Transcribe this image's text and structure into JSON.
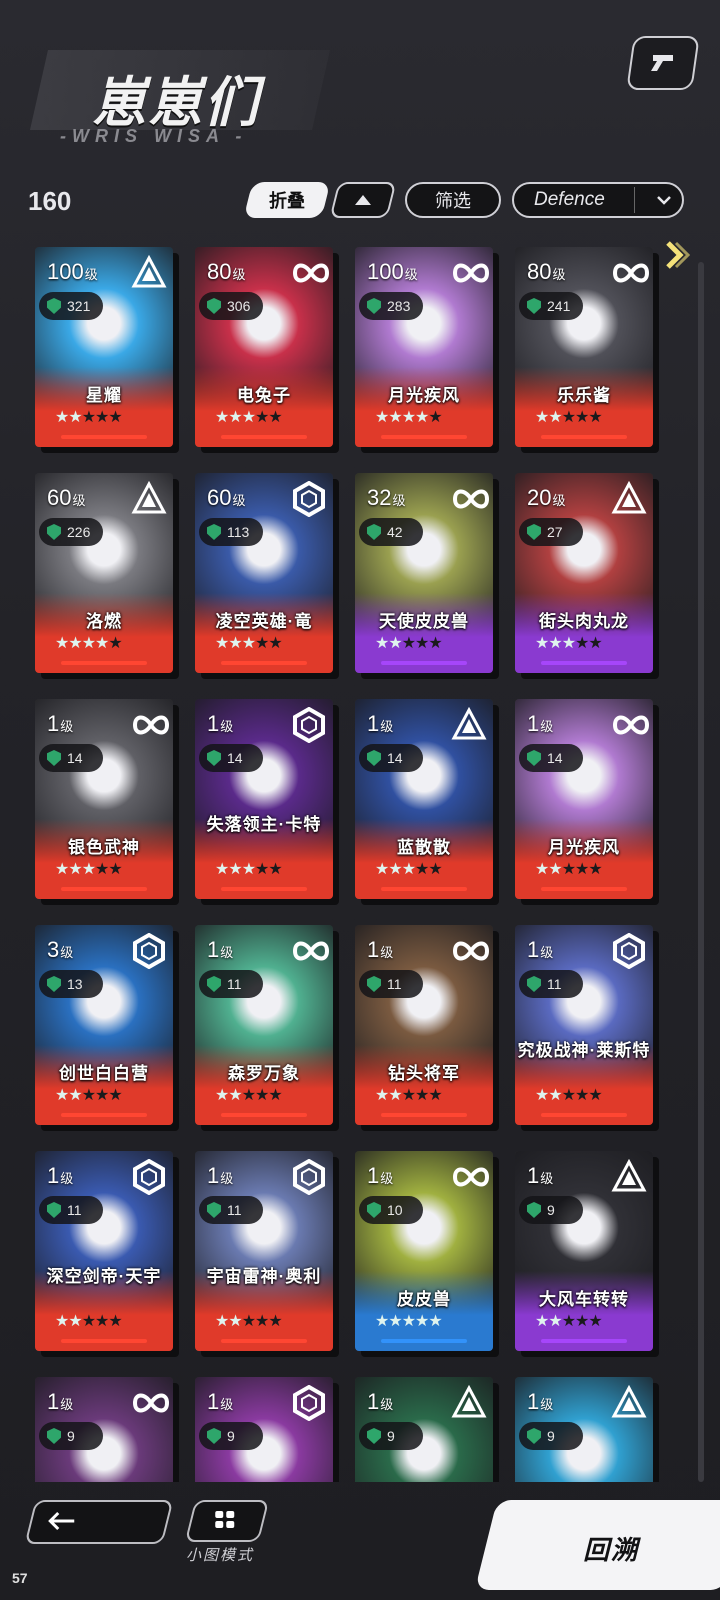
{
  "header": {
    "title": "崽崽们",
    "subtitle": "-WRIS WISA -",
    "count": "160",
    "fold_label": "折叠",
    "filter_label": "筛选",
    "sort_value": "Defence",
    "level_suffix": "级"
  },
  "cards": [
    {
      "level": "100",
      "power": "321",
      "name": "星耀",
      "type": "triangle",
      "stars": 2,
      "rarity": "red",
      "art": "#3aa8e6"
    },
    {
      "level": "80",
      "power": "306",
      "name": "电兔子",
      "type": "infinity",
      "stars": 3,
      "rarity": "red",
      "art": "#c8304a"
    },
    {
      "level": "100",
      "power": "283",
      "name": "月光疾风",
      "type": "infinity",
      "stars": 4,
      "rarity": "red",
      "art": "#b07ad0"
    },
    {
      "level": "80",
      "power": "241",
      "name": "乐乐酱",
      "type": "infinity",
      "stars": 2,
      "rarity": "red",
      "art": "#505058"
    },
    {
      "level": "60",
      "power": "226",
      "name": "洛燃",
      "type": "triangle",
      "stars": 4,
      "rarity": "red",
      "art": "#7a7a80"
    },
    {
      "level": "60",
      "power": "113",
      "name": "凌空英雄·竜",
      "type": "hex",
      "stars": 3,
      "rarity": "red",
      "art": "#3a5aa8"
    },
    {
      "level": "32",
      "power": "42",
      "name": "天使皮皮兽",
      "type": "infinity",
      "stars": 2,
      "rarity": "purple",
      "art": "#9aa050"
    },
    {
      "level": "20",
      "power": "27",
      "name": "街头肉丸龙",
      "type": "triangle",
      "stars": 3,
      "rarity": "purple",
      "art": "#b04040"
    },
    {
      "level": "1",
      "power": "14",
      "name": "银色武神",
      "type": "infinity",
      "stars": 3,
      "rarity": "red",
      "art": "#606066"
    },
    {
      "level": "1",
      "power": "14",
      "name": "失落领主·卡特",
      "type": "hex",
      "stars": 3,
      "rarity": "red",
      "art": "#5a2a8a"
    },
    {
      "level": "1",
      "power": "14",
      "name": "蓝散散",
      "type": "triangle",
      "stars": 3,
      "rarity": "red",
      "art": "#3050a0"
    },
    {
      "level": "1",
      "power": "14",
      "name": "月光疾风",
      "type": "infinity",
      "stars": 2,
      "rarity": "red",
      "art": "#b07ad0"
    },
    {
      "level": "3",
      "power": "13",
      "name": "创世白白营",
      "type": "hex",
      "stars": 2,
      "rarity": "red",
      "art": "#2a70c0"
    },
    {
      "level": "1",
      "power": "11",
      "name": "森罗万象",
      "type": "infinity",
      "stars": 2,
      "rarity": "red",
      "art": "#50b090"
    },
    {
      "level": "1",
      "power": "11",
      "name": "钻头将军",
      "type": "infinity",
      "stars": 2,
      "rarity": "red",
      "art": "#7a5a40"
    },
    {
      "level": "1",
      "power": "11",
      "name": "究极战神·莱斯特",
      "type": "hex",
      "stars": 2,
      "rarity": "red",
      "art": "#5a6ac0"
    },
    {
      "level": "1",
      "power": "11",
      "name": "深空剑帝·天宇",
      "type": "hex",
      "stars": 2,
      "rarity": "red",
      "art": "#3a5ab0"
    },
    {
      "level": "1",
      "power": "11",
      "name": "宇宙雷神·奥利",
      "type": "hex",
      "stars": 2,
      "rarity": "red",
      "art": "#6a7ab0"
    },
    {
      "level": "1",
      "power": "10",
      "name": "皮皮兽",
      "type": "infinity",
      "stars": 5,
      "rarity": "blue",
      "art": "#a0b040"
    },
    {
      "level": "1",
      "power": "9",
      "name": "大风车转转",
      "type": "triangle",
      "stars": 2,
      "rarity": "purple",
      "art": "#303036"
    },
    {
      "level": "1",
      "power": "9",
      "name": "",
      "type": "infinity",
      "stars": 0,
      "rarity": "red",
      "art": "#6a3a7a"
    },
    {
      "level": "1",
      "power": "9",
      "name": "",
      "type": "hex",
      "stars": 0,
      "rarity": "red",
      "art": "#8a3aa0"
    },
    {
      "level": "1",
      "power": "9",
      "name": "",
      "type": "triangle",
      "stars": 0,
      "rarity": "red",
      "art": "#2a6a4a"
    },
    {
      "level": "1",
      "power": "9",
      "name": "",
      "type": "triangle",
      "stars": 0,
      "rarity": "red",
      "art": "#30a0d0"
    }
  ],
  "footer": {
    "mini_mode_label": "小图模式",
    "return_label": "回溯",
    "fps": "57"
  },
  "colors": {
    "red": "#e03a2a",
    "purple": "#8a3ad0",
    "blue": "#2a7ad0"
  }
}
